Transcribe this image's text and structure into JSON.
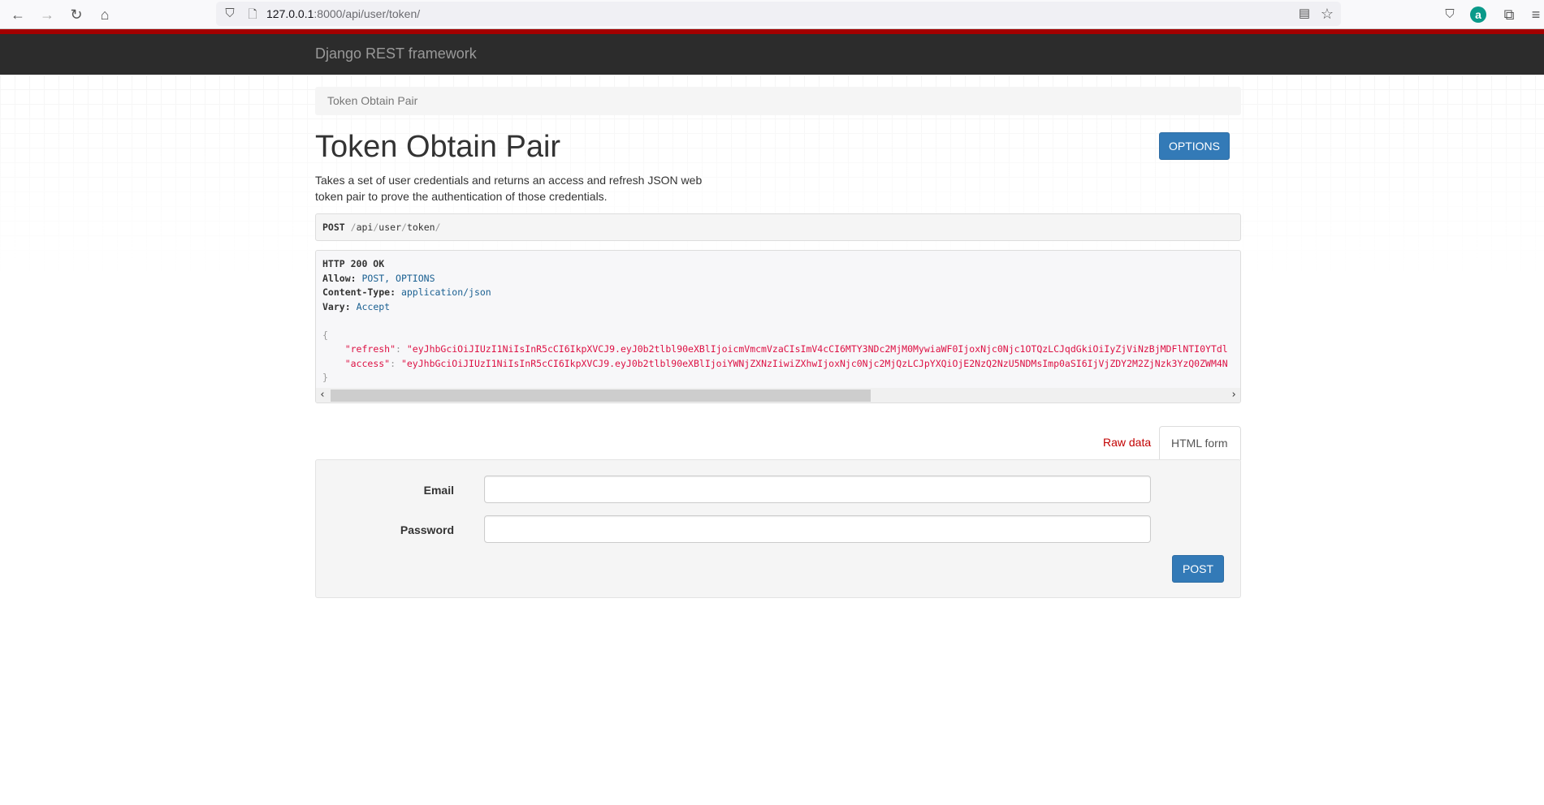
{
  "browser": {
    "url_host": "127.0.0.1",
    "url_rest": ":8000/api/user/token/",
    "icons": [
      "back-icon",
      "forward-icon",
      "reload-icon",
      "home-icon",
      "shield-icon",
      "page-icon",
      "reader-view-icon",
      "bookmark-star-icon",
      "pocket-icon",
      "account-avatar-icon",
      "extensions-icon",
      "menu-icon"
    ],
    "avatar_letter": "a"
  },
  "navbar": {
    "brand": "Django REST framework"
  },
  "breadcrumb": {
    "current": "Token Obtain Pair"
  },
  "page": {
    "title": "Token Obtain Pair",
    "options_label": "OPTIONS",
    "description": "Takes a set of user credentials and returns an access and refresh JSON web token pair to prove the authentication of those credentials."
  },
  "request": {
    "method": "POST",
    "path_parts": [
      "api",
      "user",
      "token"
    ]
  },
  "response": {
    "status": "HTTP 200 OK",
    "headers": [
      {
        "name": "Allow:",
        "value": "POST, OPTIONS"
      },
      {
        "name": "Content-Type:",
        "value": "application/json"
      },
      {
        "name": "Vary:",
        "value": "Accept"
      }
    ],
    "body": {
      "refresh_key": "\"refresh\"",
      "refresh_value": "\"eyJhbGciOiJIUzI1NiIsInR5cCI6IkpXVCJ9.eyJ0b2tlbl90eXBlIjoicmVmcmVzaCIsImV4cCI6MTY3NDc2MjM0MywiaWF0IjoxNjc0Njc1OTQzLCJqdGkiOiIyZjViNzBjMDFlNTI0YTdl",
      "access_key": "\"access\"",
      "access_value": "\"eyJhbGciOiJIUzI1NiIsInR5cCI6IkpXVCJ9.eyJ0b2tlbl90eXBlIjoiYWNjZXNzIiwiZXhwIjoxNjc0Njc2MjQzLCJpYXQiOjE2NzQ2NzU5NDMsImp0aSI6IjVjZDY2M2ZjNzk3YzQ0ZWM4N"
    }
  },
  "tabs": [
    {
      "label": "Raw data",
      "active": false
    },
    {
      "label": "HTML form",
      "active": true
    }
  ],
  "form": {
    "fields": [
      {
        "label": "Email",
        "value": ""
      },
      {
        "label": "Password",
        "value": ""
      }
    ],
    "submit_label": "POST"
  }
}
